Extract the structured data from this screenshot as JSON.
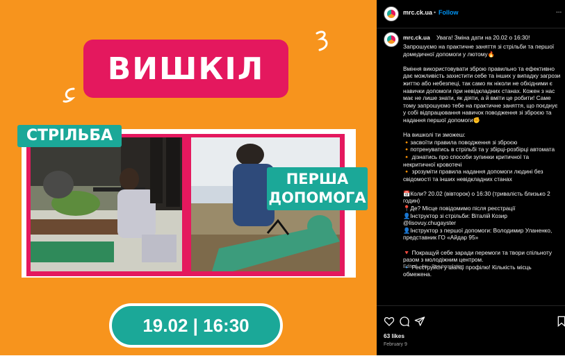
{
  "post": {
    "title": "ВИШКІЛ",
    "label_shooting": "СТРІЛЬБА",
    "label_aid_line1": "ПЕРША",
    "label_aid_line2": "ДОПОМОГА",
    "date_time": "19.02 | 16:30"
  },
  "header": {
    "username": "mrc.ck.ua",
    "separator": "•",
    "follow": "Follow",
    "more": "..."
  },
  "caption": {
    "username": "mrc.ck.ua",
    "headline": "Увага! Зміна дати на 20.02 о 16:30!",
    "body": "Запрошуємо на практичне заняття зі стрільби та першої домедичної допомоги у лютому🔥\n\nВміння використовувати зброю правильно та ефективно дає можливість захистити себе та інших у випадку загрози життю або небезпеці, так само як ніколи не обхідними є навички допомоги при невідкладних станах. Кожен з нас має не лише знати, як діяти, а й вміти це робити! Саме тому запрошуємо тебе на практичне заняття, що поєднує у собі відпрацювання навичок поводження зі зброєю та надання першої допомоги✊\n\nНа вишколі ти зможеш:\n🔸засвоїти правила поводження зі зброєю\n🔸потренуватись в стрільбі та у збірці-розбірці автомата\n🔸 дізнатись про способи зупинки критичної та некритичної кровотечі\n🔸 зрозуміти правила надання допомоги людині без свідомості та інших невідкладних станах\n\n📅Коли? 20.02 (вівторок) о 16:30 (тривалість близько 2 годин)\n📍Де? Місце повідомимо після реєстрації\n👤Інструктор зі стрільби: Віталій Козир @lisovuy.chugayster\n👤Інструктор з першої допомоги: Володимир Уланенко, представник ГО «Айдар 95»\n\n🔻 Покращуй себе заради перемоги та твори спільноту разом з молодіжним центром.\n🔹 Реєструйся у шапці профілю! Кількість місць обмежена.",
    "edited": "Edited · 4w",
    "see_translation": "See translation"
  },
  "footer": {
    "likes": "63 likes",
    "date": "February 9"
  },
  "icons": [
    "heart-icon",
    "comment-icon",
    "share-icon",
    "bookmark-icon"
  ],
  "colors": {
    "background_orange": "#f7941d",
    "accent_pink": "#e4185e",
    "accent_teal": "#1ba898",
    "follow_blue": "#0095f6"
  }
}
